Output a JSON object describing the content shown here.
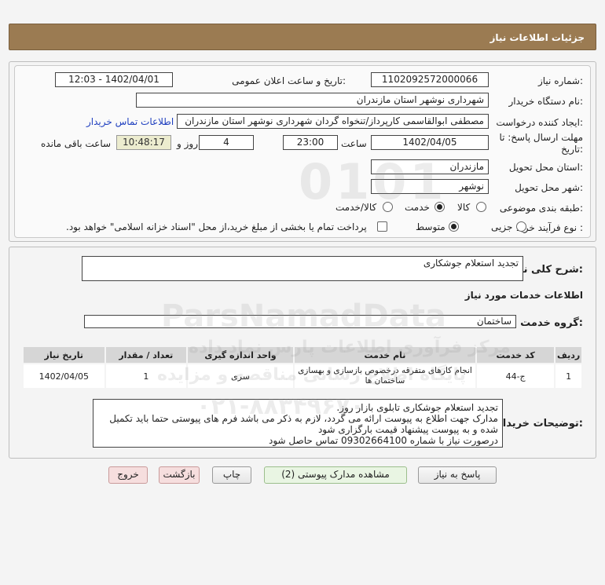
{
  "header": {
    "title": "جزئیات اطلاعات نیاز"
  },
  "form": {
    "need_number_label": "شماره نیاز:",
    "need_number": "1102092572000066",
    "announce_label": "تاریخ و ساعت اعلان عمومی:",
    "announce_value": "1402/04/01 - 12:03",
    "buyer_label": "نام دستگاه خریدار:",
    "buyer_value": "شهرداری نوشهر استان مازندران",
    "creator_label": "ایجاد کننده درخواست:",
    "creator_value": "مصطفی  ابوالقاسمی کارپرداز/تنخواه گردان شهرداری نوشهر استان مازندران",
    "contact_link": "اطلاعات تماس خریدار",
    "deadline_label_1": "مهلت ارسال پاسخ: تا",
    "deadline_label_2": "تاریخ:",
    "deadline_date": "1402/04/05",
    "time_label": "ساعت",
    "deadline_time": "23:00",
    "days_value": "4",
    "days_label": "روز و",
    "remaining_time": "10:48:17",
    "remaining_label": "ساعت باقی مانده",
    "province_label": "استان محل تحویل:",
    "province_value": "مازندران",
    "city_label": "شهر محل تحویل:",
    "city_value": "نوشهر",
    "category_label": "طبقه بندی موضوعی:",
    "category_options": [
      "کالا",
      "خدمت",
      "کالا/خدمت"
    ],
    "category_selected": "خدمت",
    "process_label": "نوع فرآیند خرید :",
    "process_options": [
      "جزیی",
      "متوسط"
    ],
    "process_selected": "متوسط",
    "treasury_text": "پرداخت تمام یا بخشی از مبلغ خرید،از محل \"اسناد خزانه اسلامی\" خواهد بود."
  },
  "details": {
    "summary_label": "شرح کلی نیاز:",
    "summary_value": "تجدید استعلام جوشکاری",
    "services_title": "اطلاعات خدمات مورد نیاز",
    "service_group_label": "گروه خدمت:",
    "service_group_value": "ساختمان",
    "table": {
      "headers": [
        "ردیف",
        "کد خدمت",
        "نام خدمت",
        "واحد اندازه گیری",
        "تعداد / مقدار",
        "تاریخ نیاز"
      ],
      "rows": [
        [
          "1",
          "ج-44",
          "انجام کارهای متفرقه درخصوص بازسازی و بهسازی ساختمان ها",
          "سری",
          "1",
          "1402/04/05"
        ]
      ]
    },
    "notes_label": "توضیحات خریدار:",
    "notes_lines": [
      "تجدید استعلام جوشکاری تابلوی بازار روز.",
      "مدارک جهت اطلاع به پیوست ارائه می گردد، لازم به ذکر می باشد فرم های پیوستی حتما باید تکمیل",
      "شده و به پیوست پیشنهاد قیمت بارگزاری شود",
      "درصورت نیاز با شماره 09302664100 تماس حاصل شود"
    ]
  },
  "buttons": {
    "reply": "پاسخ به نیاز",
    "attachments": "مشاهده مدارک پیوستی (2)",
    "print": "چاپ",
    "back": "بازگشت",
    "exit": "خروج"
  },
  "watermark": {
    "line1": "0101",
    "line2": "ParsNamadData",
    "line3": "مرکز فرآوری اطلاعات پارس نماد داده",
    "line4": "پایگاه اطلاع رسانی مناقصه و مزایده",
    "line5": "۰۲۱-۸۸۳۴۹۶۷۰"
  },
  "colors": {
    "header_bg": "#9b7b52",
    "link": "#1f3fbf",
    "timer_bg": "#ececcf"
  }
}
